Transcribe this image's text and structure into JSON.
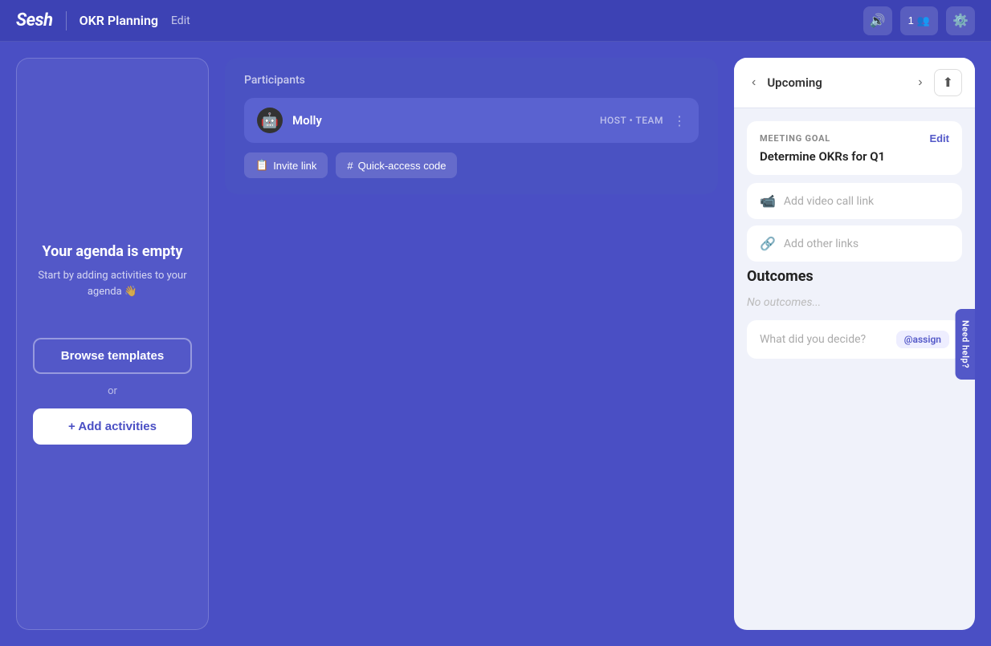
{
  "header": {
    "logo": "Sesh",
    "title": "OKR Planning",
    "edit_label": "Edit",
    "participants_count": "1",
    "participants_icon": "👥",
    "audio_icon": "🔊",
    "settings_icon": "⚙️"
  },
  "agenda": {
    "empty_title": "Your agenda is empty",
    "empty_subtitle": "Start by adding activities to your agenda 👋",
    "browse_templates_label": "Browse templates",
    "or_text": "or",
    "add_activities_label": "+ Add activities"
  },
  "participants": {
    "section_label": "Participants",
    "list": [
      {
        "name": "Molly",
        "avatar": "🤖",
        "role": "HOST • TEAM"
      }
    ],
    "invite_link_label": "Invite link",
    "quick_access_label": "Quick-access code"
  },
  "right_panel": {
    "nav_prev": "‹",
    "nav_next": "›",
    "upcoming_label": "Upcoming",
    "share_icon": "↑",
    "meeting_goal": {
      "section_label": "MEETING GOAL",
      "edit_label": "Edit",
      "value": "Determine OKRs for Q1"
    },
    "add_video_call_label": "Add video call link",
    "add_other_links_label": "Add other links",
    "outcomes": {
      "section_label": "Outcomes",
      "no_outcomes_text": "No outcomes...",
      "input_placeholder": "What did you decide?",
      "assign_badge": "@assign"
    },
    "need_help_label": "Need help?"
  }
}
